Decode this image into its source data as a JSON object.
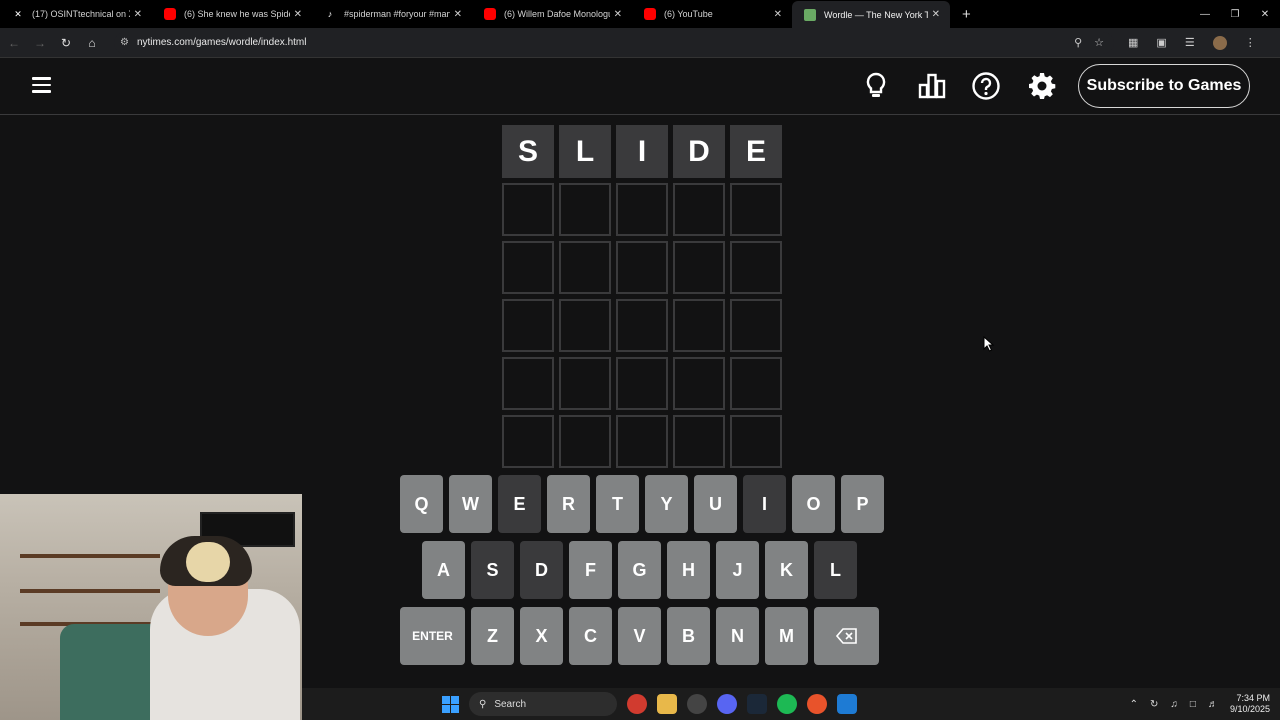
{
  "browser": {
    "tabs": [
      {
        "title": "(17) OSINTtechnical on X: \"New",
        "icon": "x-logo-icon",
        "width": 152
      },
      {
        "title": "(6) She knew he was Spider Ma",
        "icon": "youtube-icon",
        "width": 160
      },
      {
        "title": "#spiderman #foryour #marvels",
        "icon": "tiktok-icon",
        "width": 160
      },
      {
        "title": "(6) Willem Dafoe Monologue -",
        "icon": "youtube-icon",
        "width": 160
      },
      {
        "title": "(6) YouTube",
        "icon": "youtube-icon",
        "width": 160
      },
      {
        "title": "Wordle — The New York Times",
        "icon": "nyt-games-icon",
        "width": 158,
        "active": true
      }
    ],
    "url": "nytimes.com/games/wordle/index.html"
  },
  "header": {
    "subscribe_label": "Subscribe to Games"
  },
  "board": {
    "rows": [
      [
        {
          "letter": "S",
          "state": "absent"
        },
        {
          "letter": "L",
          "state": "absent"
        },
        {
          "letter": "I",
          "state": "absent"
        },
        {
          "letter": "D",
          "state": "absent"
        },
        {
          "letter": "E",
          "state": "absent"
        }
      ],
      [
        {
          "letter": "",
          "state": "empty"
        },
        {
          "letter": "",
          "state": "empty"
        },
        {
          "letter": "",
          "state": "empty"
        },
        {
          "letter": "",
          "state": "empty"
        },
        {
          "letter": "",
          "state": "empty"
        }
      ],
      [
        {
          "letter": "",
          "state": "empty"
        },
        {
          "letter": "",
          "state": "empty"
        },
        {
          "letter": "",
          "state": "empty"
        },
        {
          "letter": "",
          "state": "empty"
        },
        {
          "letter": "",
          "state": "empty"
        }
      ],
      [
        {
          "letter": "",
          "state": "empty"
        },
        {
          "letter": "",
          "state": "empty"
        },
        {
          "letter": "",
          "state": "empty"
        },
        {
          "letter": "",
          "state": "empty"
        },
        {
          "letter": "",
          "state": "empty"
        }
      ],
      [
        {
          "letter": "",
          "state": "empty"
        },
        {
          "letter": "",
          "state": "empty"
        },
        {
          "letter": "",
          "state": "empty"
        },
        {
          "letter": "",
          "state": "empty"
        },
        {
          "letter": "",
          "state": "empty"
        }
      ],
      [
        {
          "letter": "",
          "state": "empty"
        },
        {
          "letter": "",
          "state": "empty"
        },
        {
          "letter": "",
          "state": "empty"
        },
        {
          "letter": "",
          "state": "empty"
        },
        {
          "letter": "",
          "state": "empty"
        }
      ]
    ]
  },
  "keyboard": {
    "rows": [
      [
        {
          "key": "Q"
        },
        {
          "key": "W"
        },
        {
          "key": "E",
          "state": "absent"
        },
        {
          "key": "R"
        },
        {
          "key": "T"
        },
        {
          "key": "Y"
        },
        {
          "key": "U"
        },
        {
          "key": "I",
          "state": "absent"
        },
        {
          "key": "O"
        },
        {
          "key": "P"
        }
      ],
      [
        {
          "key": "A"
        },
        {
          "key": "S",
          "state": "absent"
        },
        {
          "key": "D",
          "state": "absent"
        },
        {
          "key": "F"
        },
        {
          "key": "G"
        },
        {
          "key": "H"
        },
        {
          "key": "J"
        },
        {
          "key": "K"
        },
        {
          "key": "L",
          "state": "absent"
        }
      ],
      [
        {
          "key": "ENTER",
          "wide": true
        },
        {
          "key": "Z"
        },
        {
          "key": "X"
        },
        {
          "key": "C"
        },
        {
          "key": "V"
        },
        {
          "key": "B"
        },
        {
          "key": "N"
        },
        {
          "key": "M"
        },
        {
          "key": "",
          "wide": true,
          "icon": "backspace-icon"
        }
      ]
    ]
  },
  "taskbar": {
    "search_label": "Search",
    "time": "7:34 PM",
    "date": "9/10/2025"
  },
  "colors": {
    "background": "#121213",
    "absent": "#3a3a3c",
    "key_default": "#818384",
    "empty_border": "#3a3a3c"
  }
}
